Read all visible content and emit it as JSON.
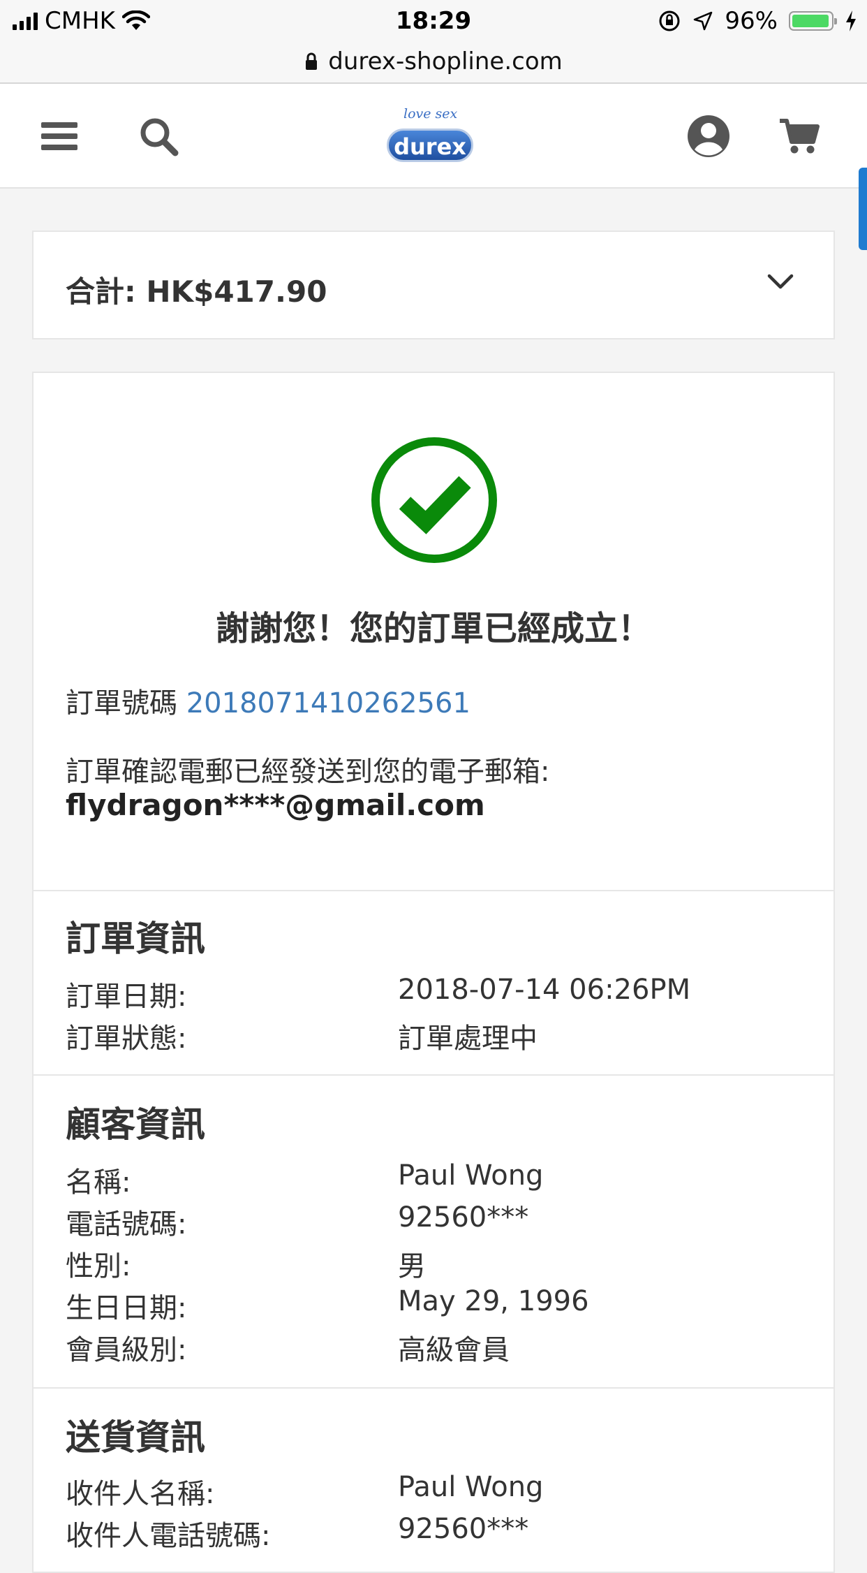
{
  "status_bar": {
    "carrier": "CMHK",
    "time": "18:29",
    "battery": "96%",
    "battery_level": 0.96
  },
  "url_bar": {
    "domain": "durex-shopline.com"
  },
  "header": {
    "logo_tagline": "love sex",
    "logo_text": "durex",
    "icons": [
      "menu-icon",
      "search-icon",
      "account-icon",
      "cart-icon"
    ]
  },
  "summary": {
    "total": "合計: HK$417.90"
  },
  "confirmation": {
    "heading": "謝謝您！您的訂單已經成立！",
    "order_number_label": "訂單號碼",
    "order_number": "2018071410262561",
    "email_notice": "訂單確認電郵已經發送到您的電子郵箱:",
    "email": "flydragon****@gmail.com",
    "check_color": "#0a8a0a"
  },
  "order_info": {
    "title": "訂單資訊",
    "rows": [
      {
        "label": "訂單日期:",
        "value": "2018-07-14 06:26PM"
      },
      {
        "label": "訂單狀態:",
        "value": "訂單處理中"
      }
    ]
  },
  "customer_info": {
    "title": "顧客資訊",
    "rows": [
      {
        "label": "名稱:",
        "value": "Paul Wong"
      },
      {
        "label": "電話號碼:",
        "value": "92560***"
      },
      {
        "label": "性別:",
        "value": "男"
      },
      {
        "label": "生日日期:",
        "value": "May 29, 1996"
      },
      {
        "label": "會員級別:",
        "value": "高級會員"
      }
    ]
  },
  "delivery_info": {
    "title": "送貨資訊",
    "rows": [
      {
        "label": "收件人名稱:",
        "value": "Paul Wong"
      },
      {
        "label": "收件人電話號碼:",
        "value": "92560***"
      }
    ]
  }
}
